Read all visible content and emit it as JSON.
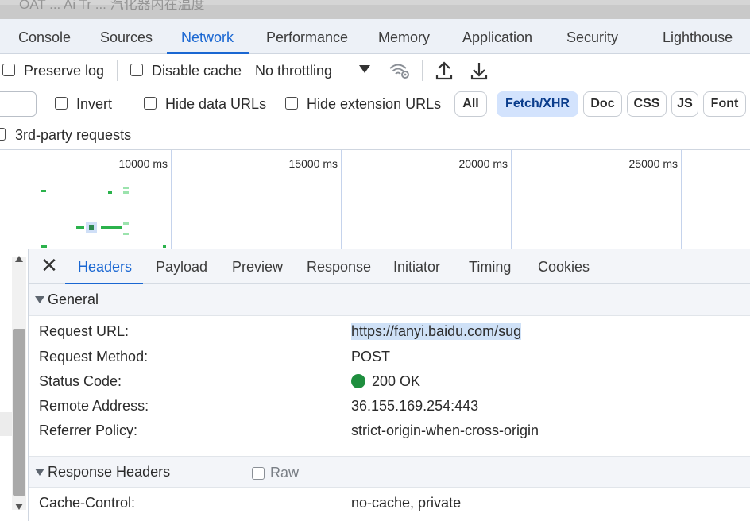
{
  "top_strip": {
    "ghost_text": "OAT ... Ai Tr ... 汽化器内在温度"
  },
  "tabs": [
    {
      "label": "Console"
    },
    {
      "label": "Sources"
    },
    {
      "label": "Network"
    },
    {
      "label": "Performance"
    },
    {
      "label": "Memory"
    },
    {
      "label": "Application"
    },
    {
      "label": "Security"
    },
    {
      "label": "Lighthouse"
    }
  ],
  "toolbar": {
    "preserve_log": "Preserve log",
    "disable_cache": "Disable cache",
    "throttling": "No throttling"
  },
  "filters": {
    "invert": "Invert",
    "hide_data_urls": "Hide data URLs",
    "hide_extension_urls": "Hide extension URLs",
    "types": [
      {
        "label": "All"
      },
      {
        "label": "Fetch/XHR"
      },
      {
        "label": "Doc"
      },
      {
        "label": "CSS"
      },
      {
        "label": "JS"
      },
      {
        "label": "Font"
      }
    ],
    "third_party": "3rd-party requests"
  },
  "timeline": {
    "ticks": [
      "10000 ms",
      "15000 ms",
      "20000 ms",
      "25000 ms"
    ]
  },
  "detail_tabs": [
    {
      "label": "Headers"
    },
    {
      "label": "Payload"
    },
    {
      "label": "Preview"
    },
    {
      "label": "Response"
    },
    {
      "label": "Initiator"
    },
    {
      "label": "Timing"
    },
    {
      "label": "Cookies"
    }
  ],
  "general": {
    "title": "General",
    "rows": [
      {
        "key": "Request URL:",
        "value": "https://fanyi.baidu.com/sug"
      },
      {
        "key": "Request Method:",
        "value": "POST"
      },
      {
        "key": "Status Code:",
        "value": "200 OK"
      },
      {
        "key": "Remote Address:",
        "value": "36.155.169.254:443"
      },
      {
        "key": "Referrer Policy:",
        "value": "strict-origin-when-cross-origin"
      }
    ]
  },
  "response_headers": {
    "title": "Response Headers",
    "raw_label": "Raw",
    "rows": [
      {
        "key": "Cache-Control:",
        "value": "no-cache, private"
      }
    ]
  },
  "colors": {
    "accent": "#1a67d2",
    "status_ok": "#1e8e3e",
    "selected_pill": "#d3e3fd"
  }
}
